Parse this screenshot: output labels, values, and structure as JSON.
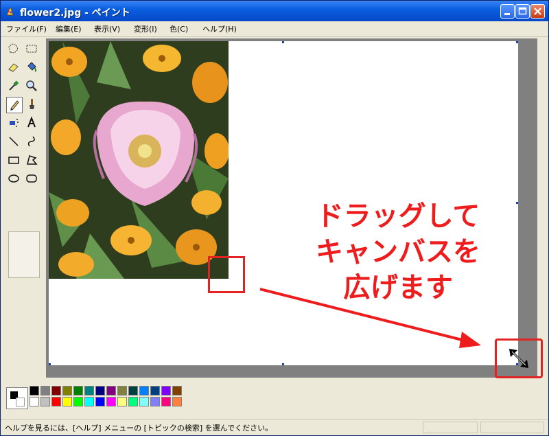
{
  "window": {
    "title": "flower2.jpg - ペイント"
  },
  "menu": {
    "items": [
      {
        "label": "ファイル(F)"
      },
      {
        "label": "編集(E)"
      },
      {
        "label": "表示(V)"
      },
      {
        "label": "変形(I)"
      },
      {
        "label": "色(C)"
      },
      {
        "label": "ヘルプ(H)"
      }
    ]
  },
  "tools": [
    "free-form-select-icon",
    "rectangle-select-icon",
    "eraser-icon",
    "fill-bucket-icon",
    "eyedropper-icon",
    "magnifier-icon",
    "pencil-icon",
    "brush-icon",
    "airbrush-icon",
    "text-icon",
    "line-icon",
    "curve-icon",
    "rectangle-icon",
    "polygon-icon",
    "ellipse-icon",
    "rounded-rectangle-icon"
  ],
  "selected_tool": "pencil-icon",
  "annotation": {
    "lines": [
      "ドラッグして",
      "キャンバスを",
      "広げます"
    ],
    "color": "#ee1c1c"
  },
  "palette": {
    "foreground": "#000000",
    "background": "#ffffff",
    "colors": [
      "#000000",
      "#808080",
      "#800000",
      "#808000",
      "#008000",
      "#008080",
      "#000080",
      "#800080",
      "#808040",
      "#004040",
      "#0080ff",
      "#004080",
      "#8000ff",
      "#804000",
      "#ffffff",
      "#c0c0c0",
      "#ff0000",
      "#ffff00",
      "#00ff00",
      "#00ffff",
      "#0000ff",
      "#ff00ff",
      "#ffff80",
      "#00ff80",
      "#80ffff",
      "#8080ff",
      "#ff0080",
      "#ff8040"
    ]
  },
  "status": {
    "text": "ヘルプを見るには、[ヘルプ] メニューの [トピックの検索] を選んでください。"
  }
}
